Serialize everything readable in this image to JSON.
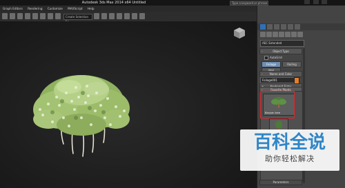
{
  "window": {
    "title": "Autodesk 3ds Max  2014 x64     Untitled",
    "search_placeholder": "Type a keyword or phrase"
  },
  "menubar": {
    "items": [
      "Graph Editors",
      "Rendering",
      "Customize",
      "MAXScript",
      "Help"
    ]
  },
  "toolbar": {
    "selection_set_placeholder": "Create Selection Se"
  },
  "command_panel": {
    "category_dropdown": "AEC Extended",
    "object_type_header": "Object Type",
    "autogrid_label": "AutoGrid",
    "buttons": [
      "Foliage",
      "Railing",
      "Wall"
    ],
    "active_button": "Foliage",
    "name_color_header": "Name and Color",
    "object_name": "Foliage001",
    "object_color": "#e07f2f",
    "keyboard_entry_header": "Keyboard Entry",
    "favorite_plants_header": "Favorite Plants",
    "selected_plant_label": "Banyan tree",
    "parameters_header": "Parameters"
  },
  "watermark": {
    "main": "百科全说",
    "sub": "助你轻松解决"
  }
}
